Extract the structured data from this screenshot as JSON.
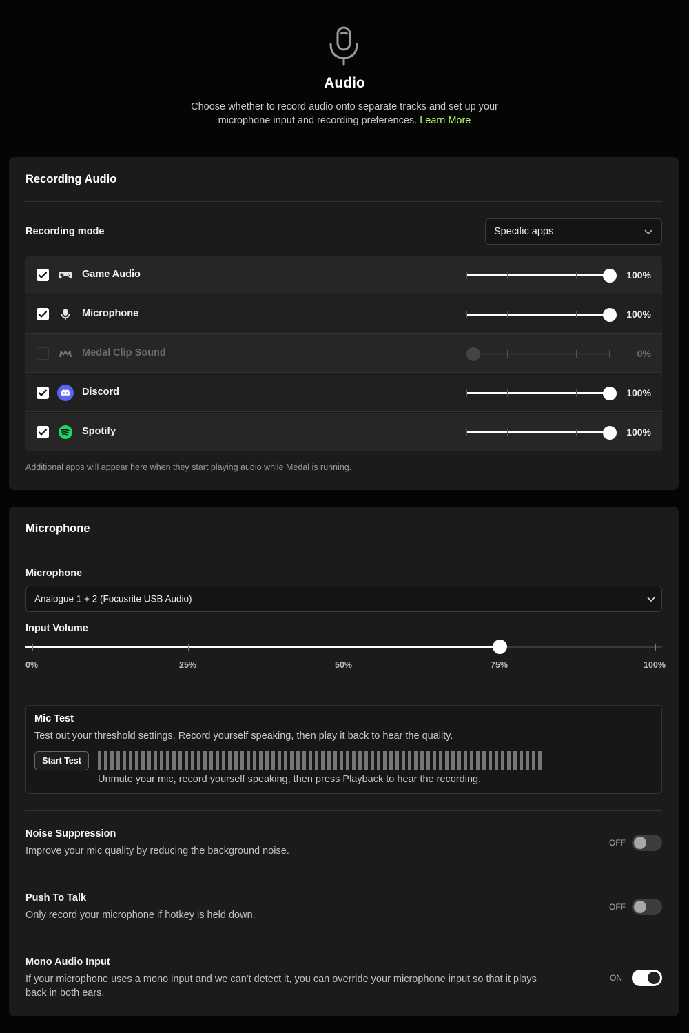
{
  "header": {
    "icon": "microphone-icon",
    "title": "Audio",
    "description": "Choose whether to record audio onto separate tracks and set up your microphone input and recording preferences.",
    "learn_more": "Learn More"
  },
  "recording_audio": {
    "title": "Recording Audio",
    "mode_label": "Recording mode",
    "mode_value": "Specific apps",
    "apps": [
      {
        "name": "Game Audio",
        "icon": "gamepad-icon",
        "checked": true,
        "volume": 100,
        "volume_label": "100%"
      },
      {
        "name": "Microphone",
        "icon": "microphone-icon",
        "checked": true,
        "volume": 100,
        "volume_label": "100%"
      },
      {
        "name": "Medal Clip Sound",
        "icon": "medal-logo-icon",
        "checked": false,
        "volume": 0,
        "volume_label": "0%"
      },
      {
        "name": "Discord",
        "icon": "discord-icon",
        "checked": true,
        "volume": 100,
        "volume_label": "100%"
      },
      {
        "name": "Spotify",
        "icon": "spotify-icon",
        "checked": true,
        "volume": 100,
        "volume_label": "100%"
      }
    ],
    "hint": "Additional apps will appear here when they start playing audio while Medal is running."
  },
  "microphone": {
    "title": "Microphone",
    "device_label": "Microphone",
    "device_value": "Analogue 1 + 2 (Focusrite USB Audio)",
    "input_volume_label": "Input Volume",
    "input_volume": 75,
    "volume_marks": [
      "0%",
      "25%",
      "50%",
      "75%",
      "100%"
    ],
    "mic_test": {
      "title": "Mic Test",
      "description": "Test out your threshold settings. Record yourself speaking, then play it back to hear the quality.",
      "button": "Start Test",
      "note": "Unmute your mic, record yourself speaking, then press Playback to hear the recording."
    },
    "options": [
      {
        "title": "Noise Suppression",
        "description": "Improve your mic quality by reducing the background noise.",
        "state": "OFF"
      },
      {
        "title": "Push To Talk",
        "description": "Only record your microphone if hotkey is held down.",
        "state": "OFF"
      },
      {
        "title": "Mono Audio Input",
        "description": "If your microphone uses a mono input and we can't detect it, you can override your microphone input so that it plays back in both ears.",
        "state": "ON"
      }
    ]
  },
  "colors": {
    "accent": "#b4ff5c",
    "discord": "#5865f2",
    "spotify": "#1ed760"
  }
}
